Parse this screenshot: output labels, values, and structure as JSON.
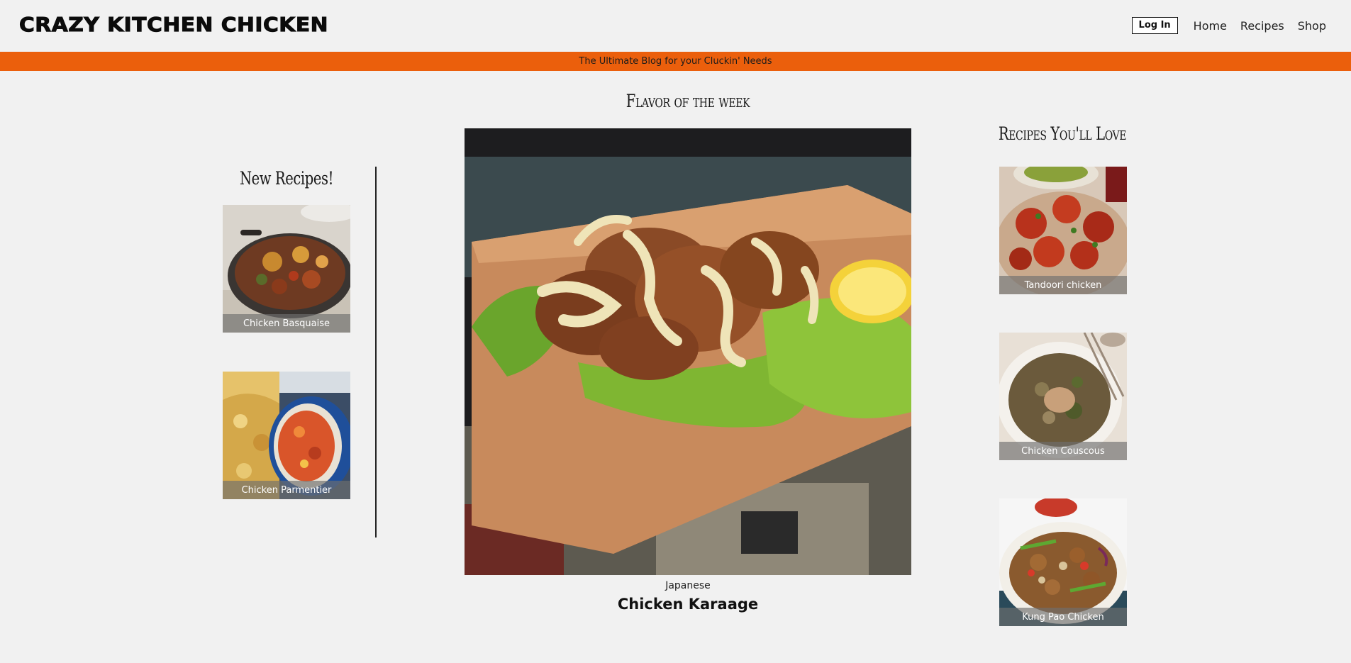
{
  "header": {
    "logo_text": "CRAZY KITCHEN CHICKEN",
    "login_label": "Log In",
    "nav": [
      {
        "label": "Home"
      },
      {
        "label": "Recipes"
      },
      {
        "label": "Shop"
      }
    ]
  },
  "banner": {
    "text": "The Ultimate Blog for your Cluckin' Needs",
    "color": "#eb5f0c"
  },
  "new_recipes": {
    "title": "New Recipes!",
    "items": [
      {
        "name": "Chicken Basquaise"
      },
      {
        "name": "Chicken Parmentier"
      }
    ]
  },
  "featured": {
    "title": "Flavor of the week",
    "category": "Japanese",
    "name": "Chicken Karaage"
  },
  "recommended": {
    "title": "Recipes You'll Love",
    "items": [
      {
        "name": "Tandoori chicken"
      },
      {
        "name": "Chicken Couscous"
      },
      {
        "name": "Kung Pao Chicken"
      }
    ]
  }
}
